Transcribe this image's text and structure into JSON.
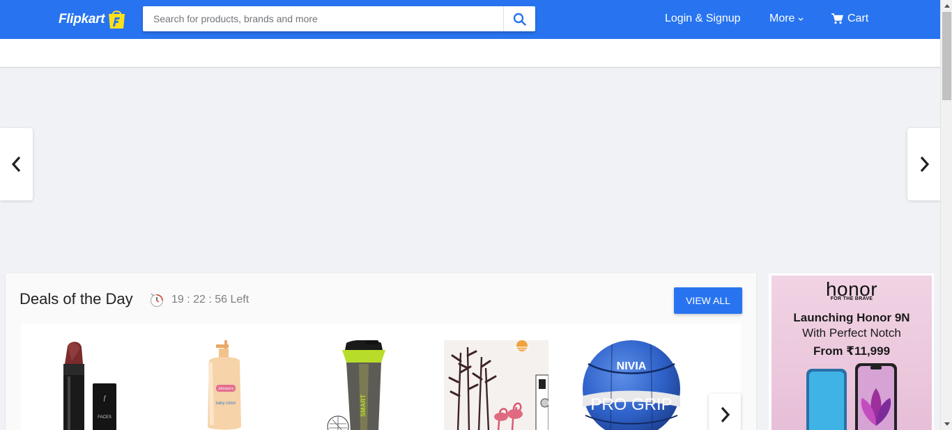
{
  "header": {
    "logo_text": "Flipkart",
    "search_placeholder": "Search for products, brands and more",
    "login_label": "Login & Signup",
    "more_label": "More",
    "cart_label": "Cart",
    "brand_color": "#2874f0",
    "logo_accent": "#ffe11b"
  },
  "icons": {
    "search": "search-icon",
    "cart": "cart-icon",
    "chevron": "chevron-down-icon",
    "prev": "chevron-left-icon",
    "next": "chevron-right-icon",
    "timer": "clock-icon"
  },
  "deals": {
    "title": "Deals of the Day",
    "timer_text": "19 : 22 : 56 Left",
    "view_all_label": "VIEW ALL",
    "products": [
      {
        "name": "lipstick",
        "label": "FACES"
      },
      {
        "name": "baby-lotion",
        "label": "baby lotion"
      },
      {
        "name": "shaker-bottle",
        "label": "SMART"
      },
      {
        "name": "wall-decal",
        "label": ""
      },
      {
        "name": "basketball",
        "label": "PRO GRIP"
      }
    ]
  },
  "ad": {
    "brand": "honor",
    "tagline": "FOR THE BRAVE",
    "line1": "Launching Honor 9N",
    "line2": "With Perfect Notch",
    "line3": "From ₹11,999"
  }
}
